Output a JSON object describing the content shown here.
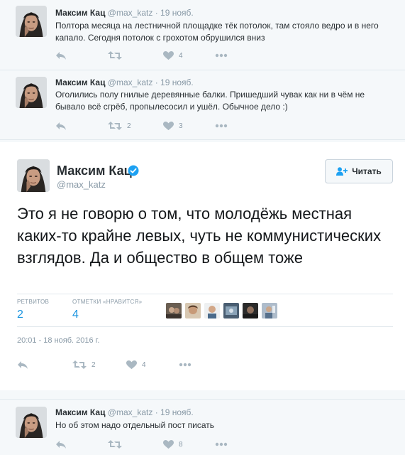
{
  "tweets_top": [
    {
      "name": "Максим Кац",
      "handle": "@max_katz",
      "dot": "·",
      "date": "19 нояб.",
      "text": "Полтора месяца на лестничной площадке тёк потолок, там стояло ведро и в него капало. Сегодня потолок с грохотом обрушился вниз",
      "retweets": "",
      "likes": "4"
    },
    {
      "name": "Максим Кац",
      "handle": "@max_katz",
      "dot": "·",
      "date": "19 нояб.",
      "text": "Оголились полу гнилые деревянные балки. Пришедший чувак как ни в чём не бывало всё сгрёб, пропылесосил и ушёл. Обычное дело :)",
      "retweets": "2",
      "likes": "3"
    }
  ],
  "main_tweet": {
    "name": "Максим Кац",
    "handle": "@max_katz",
    "follow_label": "Читать",
    "text": "Это я не говорю о том, что молодёжь местная каких-то крайне левых, чуть не коммунистических взглядов. Да и общество в общем тоже",
    "retweets_label": "РЕТВИТОВ",
    "retweets_value": "2",
    "likes_label": "ОТМЕТКИ «НРАВИТСЯ»",
    "likes_value": "4",
    "timestamp": "20:01 - 18 нояб. 2016 г.",
    "action_retweets": "2",
    "action_likes": "4"
  },
  "tweet_bottom": {
    "name": "Максим Кац",
    "handle": "@max_katz",
    "dot": "·",
    "date": "19 нояб.",
    "text": "Но об этом надо отдельный пост писать",
    "retweets": "",
    "likes": "8"
  },
  "icons": {
    "reply": "reply-icon",
    "retweet": "retweet-icon",
    "like": "heart-icon",
    "more": "more-icon",
    "verified": "verified-badge-icon",
    "follow": "follow-person-icon"
  },
  "colors": {
    "link_blue": "#1b95e0",
    "muted": "#8899a6",
    "icon_gray": "#aab8c2",
    "background": "#f5f8fa",
    "card": "#ffffff"
  }
}
